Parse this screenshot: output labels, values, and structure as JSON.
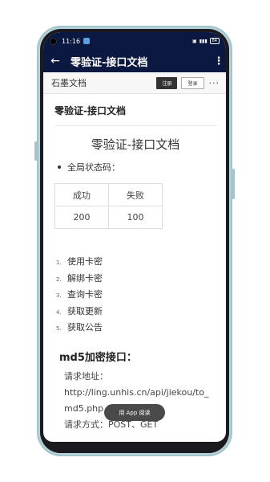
{
  "status_bar": {
    "time": "11:16",
    "battery": "84"
  },
  "app_bar": {
    "back_glyph": "←",
    "title": "零验证-接口文档",
    "more_glyph": "⋮"
  },
  "site_header": {
    "brand": "石墨文档",
    "register_label": "注册",
    "login_label": "登录",
    "more_glyph": "···"
  },
  "document": {
    "doc_title": "零验证-接口文档",
    "heading": "零验证-接口文档",
    "status_bullet": "全局状态码：",
    "status_table": {
      "headers": [
        "成功",
        "失败"
      ],
      "rows": [
        [
          "200",
          "100"
        ]
      ]
    },
    "ordered_list": [
      {
        "num": "1.",
        "label": "使用卡密"
      },
      {
        "num": "2.",
        "label": "解绑卡密"
      },
      {
        "num": "3.",
        "label": "查询卡密"
      },
      {
        "num": "4.",
        "label": "获取更新"
      },
      {
        "num": "5.",
        "label": "获取公告"
      }
    ],
    "section_heading": "md5加密接口：",
    "request_url_label": "请求地址：",
    "request_url": "http://ling.unhis.cn/api/jiekou/to_md5.php",
    "request_method": "请求方式：POST、GET"
  },
  "open_in_app_label": "用 App 阅读",
  "colors": {
    "app_bar_bg": "#0b1840",
    "frame": "#b6d3da"
  }
}
